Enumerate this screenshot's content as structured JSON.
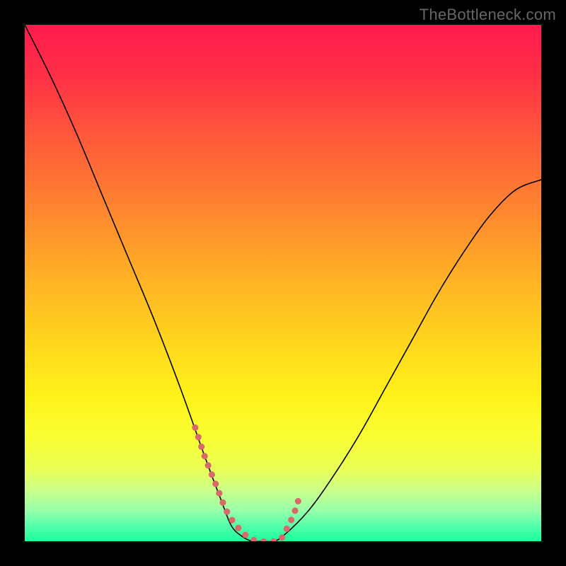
{
  "watermark": "TheBottleneck.com",
  "chart_data": {
    "type": "line",
    "title": "",
    "xlabel": "",
    "ylabel": "",
    "xlim": [
      0,
      100
    ],
    "ylim": [
      0,
      100
    ],
    "grid": false,
    "background_gradient": {
      "stops": [
        {
          "pos": 0.0,
          "color": "#ff1a4d"
        },
        {
          "pos": 0.1,
          "color": "#ff3046"
        },
        {
          "pos": 0.22,
          "color": "#ff5a3a"
        },
        {
          "pos": 0.35,
          "color": "#ff8330"
        },
        {
          "pos": 0.48,
          "color": "#ffae26"
        },
        {
          "pos": 0.6,
          "color": "#ffd21e"
        },
        {
          "pos": 0.72,
          "color": "#fff21a"
        },
        {
          "pos": 0.8,
          "color": "#f9ff33"
        },
        {
          "pos": 0.86,
          "color": "#eaff55"
        },
        {
          "pos": 0.9,
          "color": "#ccff88"
        },
        {
          "pos": 0.94,
          "color": "#99ffaa"
        },
        {
          "pos": 0.97,
          "color": "#55ffaa"
        },
        {
          "pos": 1.0,
          "color": "#1aff9e"
        }
      ]
    },
    "series": [
      {
        "name": "bottleneck-curve",
        "color": "#000000",
        "width": 1.6,
        "x": [
          0,
          5,
          10,
          15,
          20,
          25,
          30,
          35,
          38,
          40,
          42,
          44,
          46,
          48,
          50,
          55,
          60,
          65,
          70,
          75,
          80,
          85,
          90,
          95,
          100
        ],
        "values": [
          100,
          90,
          79,
          67,
          55,
          43,
          30,
          16,
          8,
          3,
          1,
          0,
          0,
          0,
          1,
          6,
          13,
          21,
          30,
          39,
          48,
          56,
          63,
          68,
          70
        ]
      },
      {
        "name": "highlight-segment",
        "color": "#d86a6a",
        "width": 9,
        "linecap": "round",
        "dash": "0.1 14",
        "x": [
          33,
          35,
          37,
          39,
          41,
          43,
          45,
          47,
          49,
          50,
          51,
          52,
          53
        ],
        "values": [
          22,
          16,
          11,
          6,
          3,
          1,
          0,
          0,
          0,
          1,
          3,
          5,
          8
        ]
      }
    ]
  }
}
